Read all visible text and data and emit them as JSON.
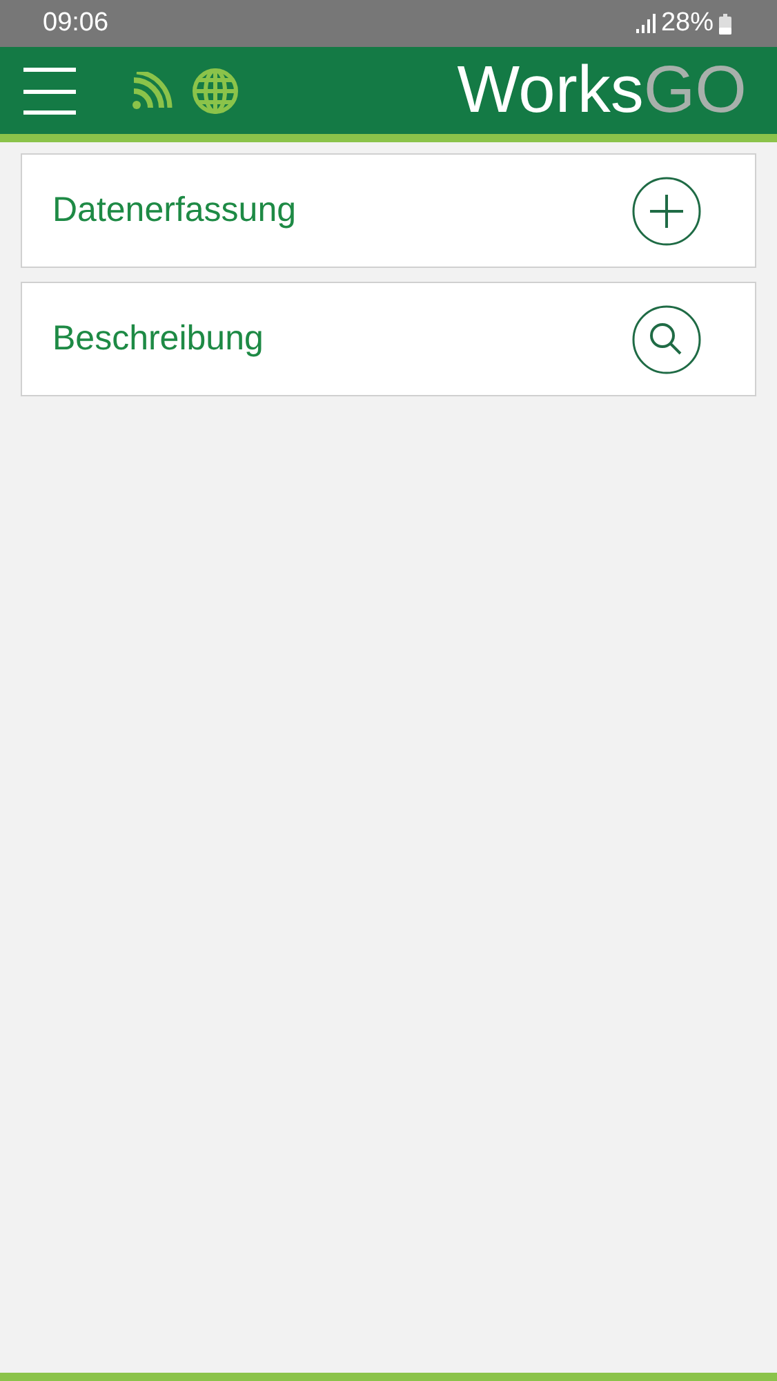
{
  "status_bar": {
    "time": "09:06",
    "battery": "28%"
  },
  "header": {
    "logo_primary": "Works",
    "logo_secondary": "GO"
  },
  "menu_items": [
    {
      "label": "Datenerfassung",
      "kind": "add"
    },
    {
      "label": "Beschreibung",
      "kind": "search"
    }
  ]
}
